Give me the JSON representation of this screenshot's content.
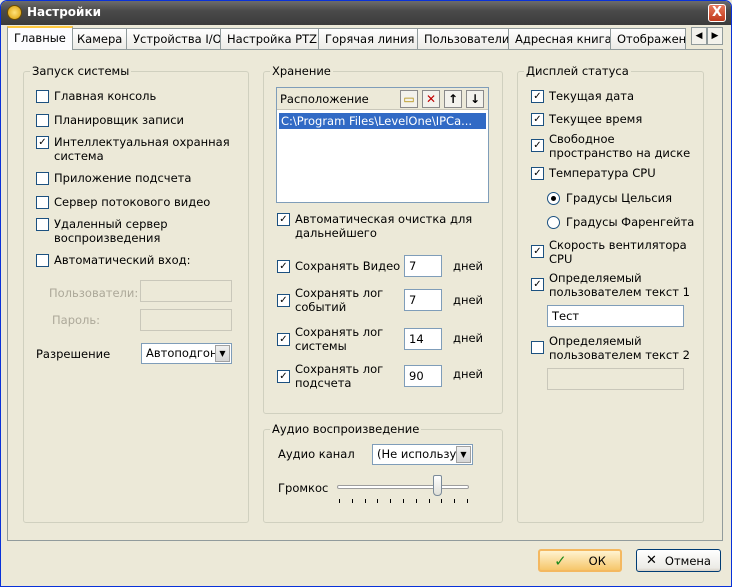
{
  "window": {
    "title": "Настройки",
    "close_glyph": "X"
  },
  "tabs": [
    "Главные",
    "Камера",
    "Устройства I/O",
    "Настройка PTZ",
    "Горячая линия",
    "Пользователи",
    "Адресная книга",
    "Отображен"
  ],
  "startup": {
    "legend": "Запуск системы",
    "items": [
      {
        "label": "Главная консоль",
        "checked": false
      },
      {
        "label": "Планировщик записи",
        "checked": false
      },
      {
        "label": "Интеллектуальная охранная система",
        "checked": true
      },
      {
        "label": "Приложение подсчета",
        "checked": false
      },
      {
        "label": "Сервер потокового видео",
        "checked": false
      },
      {
        "label": "Удаленный сервер воспроизведения",
        "checked": false
      },
      {
        "label": "Автоматический вход:",
        "checked": false
      }
    ],
    "users_label": "Пользователи:",
    "password_label": "Пароль:",
    "users_value": "",
    "password_value": "",
    "resolution_label": "Разрешение",
    "resolution_value": "Автоподгон"
  },
  "storage": {
    "legend": "Хранение",
    "location_header": "Расположение",
    "location_item": "C:\\Program Files\\LevelOne\\IPCa...",
    "auto_clean_label": "Автоматическая очистка для дальнейшего",
    "auto_clean_checked": true,
    "rows": [
      {
        "label": "Сохранять Видео",
        "value": "7",
        "unit": "дней",
        "checked": true
      },
      {
        "label": "Сохранять лог событий",
        "value": "7",
        "unit": "дней",
        "checked": true
      },
      {
        "label": "Сохранять лог системы",
        "value": "14",
        "unit": "дней",
        "checked": true
      },
      {
        "label": "Сохранять лог подсчета",
        "value": "90",
        "unit": "дней",
        "checked": true
      }
    ]
  },
  "audio": {
    "legend": "Аудио воспроизведение",
    "channel_label": "Аудио канал",
    "channel_value": "(Не использует",
    "volume_label": "Громкос",
    "volume_level": 0.78
  },
  "status": {
    "legend": "Дисплей статуса",
    "items": [
      {
        "label": "Текущая  дата",
        "checked": true
      },
      {
        "label": "Текущее время",
        "checked": true
      },
      {
        "label": "Свободное пространство на диске",
        "checked": true
      },
      {
        "label": "Температура CPU",
        "checked": true
      }
    ],
    "radios": [
      {
        "label": "Градусы Цельсия",
        "selected": true
      },
      {
        "label": "Градусы Фаренгейта",
        "selected": false
      }
    ],
    "fan_label": "Скорость вентилятора CPU",
    "fan_checked": true,
    "custom1_label": "Определяемый пользователем текст 1",
    "custom1_checked": true,
    "custom1_value": "Тест",
    "custom2_label": "Определяемый пользователем текст 2",
    "custom2_checked": false,
    "custom2_value": ""
  },
  "buttons": {
    "ok": "ОК",
    "cancel": "Отмена"
  },
  "icons": {
    "check": "✓",
    "x": "✕"
  }
}
